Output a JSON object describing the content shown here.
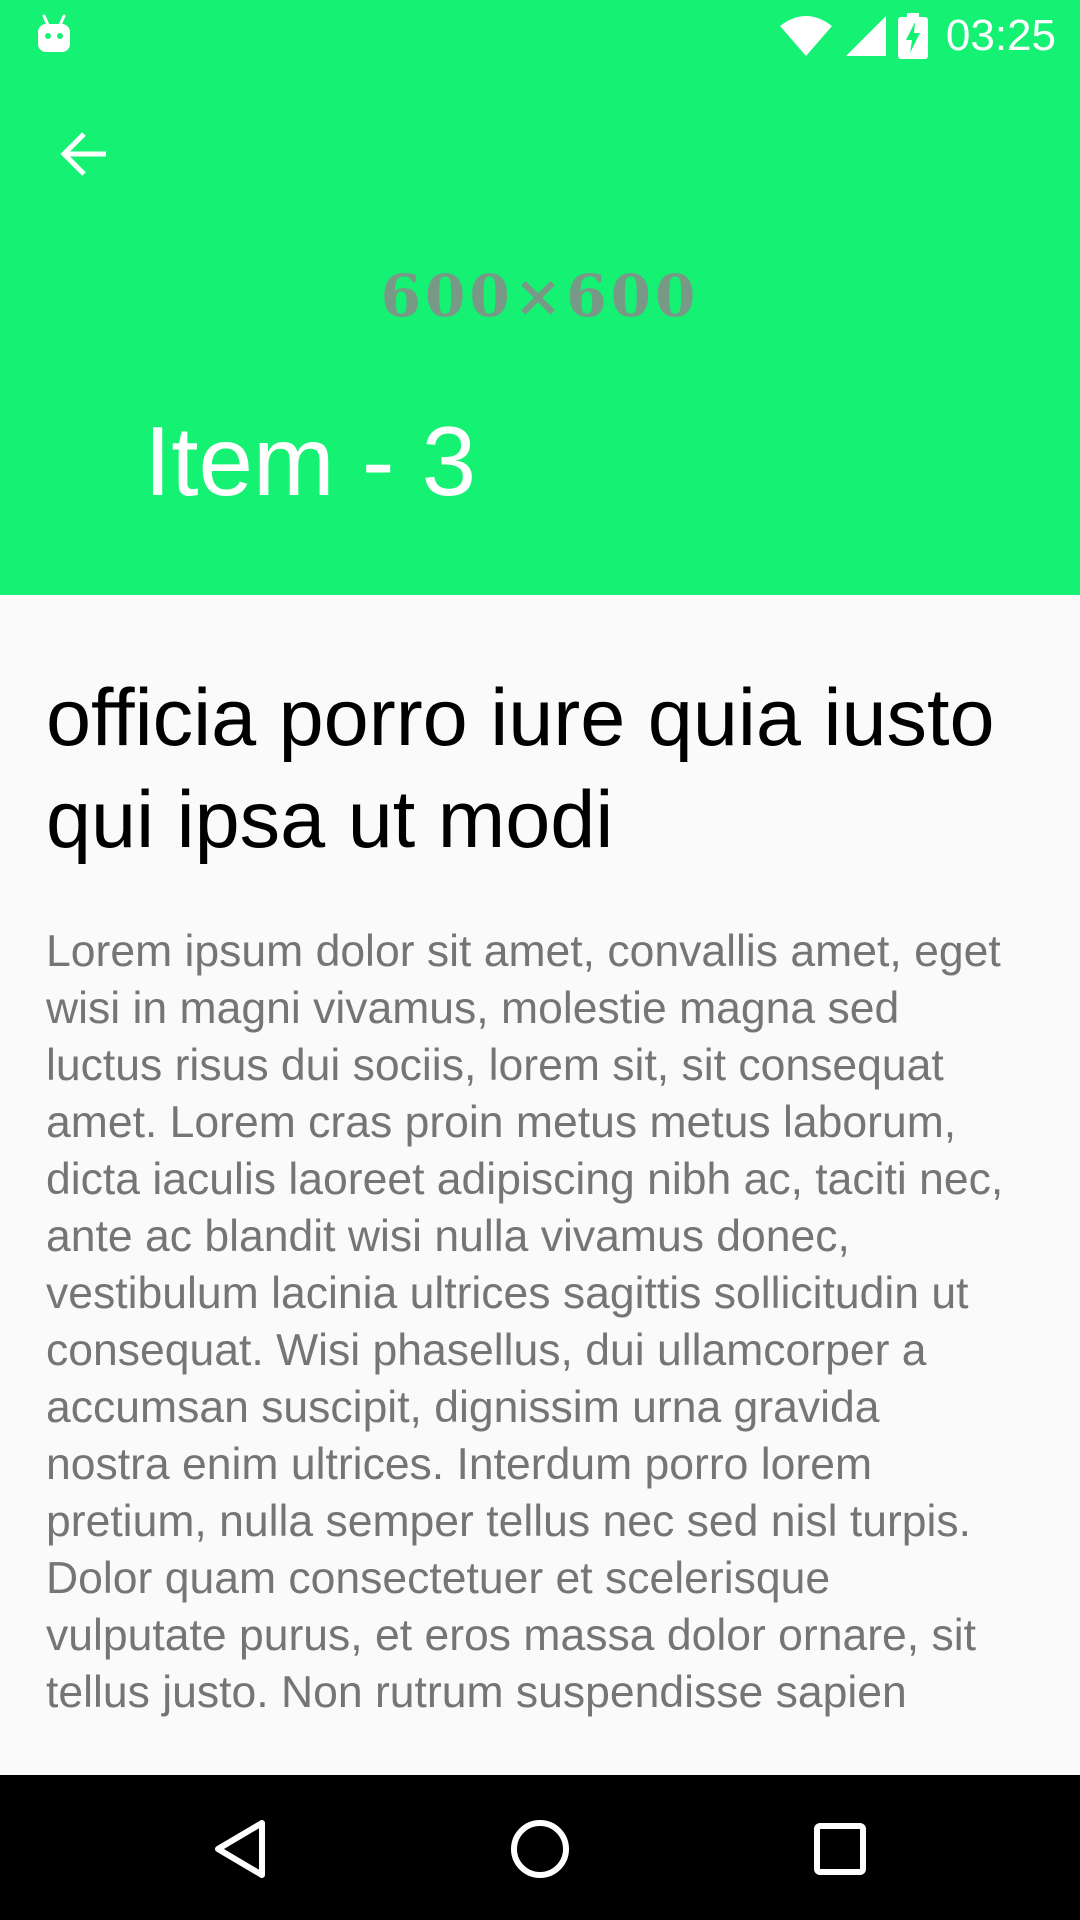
{
  "status_bar": {
    "time": "03:25",
    "icons": [
      "android-icon",
      "wifi-icon",
      "signal-icon",
      "battery-charging-icon"
    ]
  },
  "app_bar": {
    "placeholder_text": "600×600",
    "title": "Item - 3",
    "background_color": "#14f173",
    "back_icon": "arrow-back-icon"
  },
  "content": {
    "heading": "officia porro iure quia iusto qui ipsa ut modi",
    "body": "Lorem ipsum dolor sit amet, convallis amet, eget wisi in magni vivamus, molestie magna sed luctus risus dui sociis, lorem sit, sit consequat amet. Lorem cras proin metus metus laborum, dicta iaculis laoreet adipiscing nibh ac, taciti nec, ante ac blandit wisi nulla vivamus donec, vestibulum lacinia ultrices sagittis sollicitudin ut consequat. Wisi phasellus, dui ullamcorper a accumsan suscipit, dignissim urna gravida nostra enim ultrices. Interdum porro lorem pretium, nulla semper tellus nec sed nisl turpis. Dolor quam consectetuer et scelerisque vulputate purus, et eros massa dolor ornare, sit tellus justo. Non rutrum suspendisse sapien"
  },
  "nav_bar": {
    "icons": [
      "back-triangle-icon",
      "home-circle-icon",
      "recents-square-icon"
    ]
  }
}
